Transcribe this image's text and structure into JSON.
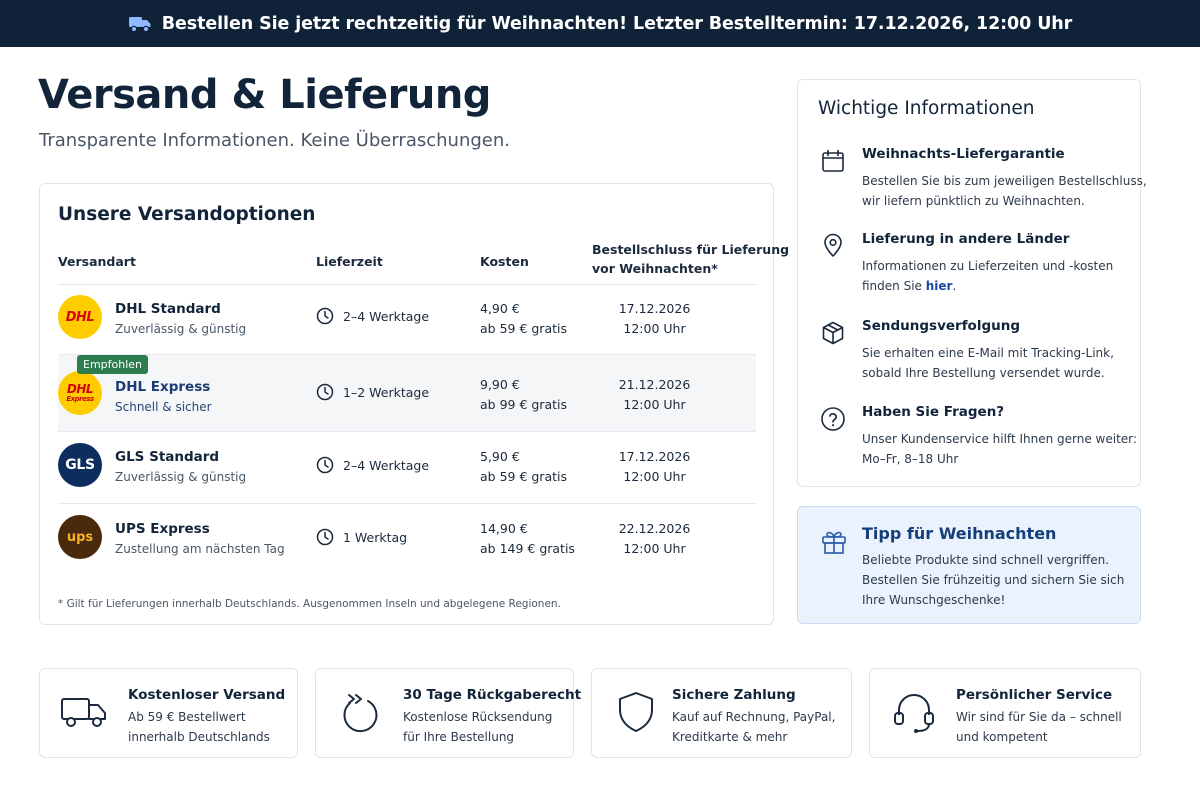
{
  "banner": {
    "text": "Bestellen Sie jetzt rechtzeitig für Weihnachten! Letzter Bestelltermin: 17.12.2026, 12:00 Uhr",
    "icon": "truck-icon"
  },
  "header": {
    "title": "Versand & Lieferung",
    "subtitle": "Transparente Informationen. Keine Überraschungen."
  },
  "shipping": {
    "title": "Unsere Versandoptionen",
    "columns": {
      "method": "Versandart",
      "time": "Lieferzeit",
      "cost": "Kosten",
      "deadline_line1": "Bestellschluss für Lieferung",
      "deadline_line2": "vor Weihnachten*"
    },
    "badge": "Empfohlen",
    "rows": [
      {
        "name": "DHL Standard",
        "desc": "Zuverlässig & günstig",
        "time": "2–4 Werktage",
        "cost": "4,90 €",
        "cost_note": "ab 59 € gratis",
        "deadline_date": "17.12.2026",
        "deadline_time": "12:00 Uhr",
        "logo": "DHL"
      },
      {
        "name": "DHL Express",
        "desc": "Schnell & sicher",
        "time": "1–2 Werktage",
        "cost": "9,90 €",
        "cost_note": "ab 99 € gratis",
        "deadline_date": "21.12.2026",
        "deadline_time": "12:00 Uhr",
        "logo": "DHL",
        "logo_sub": "Express"
      },
      {
        "name": "GLS Standard",
        "desc": "Zuverlässig & günstig",
        "time": "2–4 Werktage",
        "cost": "5,90 €",
        "cost_note": "ab 59 € gratis",
        "deadline_date": "17.12.2026",
        "deadline_time": "12:00 Uhr",
        "logo": "GLS"
      },
      {
        "name": "UPS Express",
        "desc": "Zustellung am nächsten Tag",
        "time": "1 Werktag",
        "cost": "14,90 €",
        "cost_note": "ab 149 € gratis",
        "deadline_date": "22.12.2026",
        "deadline_time": "12:00 Uhr",
        "logo": "ups"
      }
    ],
    "footnote": "* Gilt für Lieferungen innerhalb Deutschlands. Ausgenommen Inseln und abgelegene Regionen."
  },
  "info": {
    "title": "Wichtige Informationen",
    "items": [
      {
        "title": "Weihnachts-Liefergarantie",
        "line1": "Bestellen Sie bis zum jeweiligen Bestellschluss,",
        "line2": "wir liefern pünktlich zu Weihnachten.",
        "icon": "calendar-icon"
      },
      {
        "title": "Lieferung in andere Länder",
        "line1": "Informationen zu Lieferzeiten und -kosten",
        "line2_prefix": "finden Sie ",
        "link": "hier",
        "line2_suffix": ".",
        "icon": "map-pin-icon"
      },
      {
        "title": "Sendungsverfolgung",
        "line1": "Sie erhalten eine E-Mail mit Tracking-Link,",
        "line2": "sobald Ihre Bestellung versendet wurde.",
        "icon": "package-icon"
      },
      {
        "title": "Haben Sie Fragen?",
        "line1": "Unser Kundenservice hilft Ihnen gerne weiter:",
        "line2": "Mo–Fr, 8–18 Uhr",
        "icon": "question-icon"
      }
    ]
  },
  "tip": {
    "title": "Tipp für Weihnachten",
    "line1": "Beliebte Produkte sind schnell vergriffen.",
    "line2": "Bestellen Sie frühzeitig und sichern Sie sich",
    "line3": "Ihre Wunschgeschenke!",
    "icon": "gift-icon"
  },
  "features": [
    {
      "title": "Kostenloser Versand",
      "line1": "Ab 59 € Bestellwert",
      "line2": "innerhalb Deutschlands",
      "icon": "truck-icon"
    },
    {
      "title": "30 Tage Rückgaberecht",
      "line1": "Kostenlose Rücksendung",
      "line2": "für Ihre Bestellung",
      "icon": "return-icon"
    },
    {
      "title": "Sichere Zahlung",
      "line1": "Kauf auf Rechnung, PayPal,",
      "line2": "Kreditkarte & mehr",
      "icon": "shield-icon"
    },
    {
      "title": "Persönlicher Service",
      "line1": "Wir sind für Sie da – schnell",
      "line2": "und kompetent",
      "icon": "headset-icon"
    }
  ],
  "colors": {
    "banner_bg": "#0f2238",
    "dhl_yellow": "#ffcc00",
    "dhl_red": "#d40511",
    "gls_blue": "#0d2d5e",
    "ups_brown": "#4a2a0c",
    "badge_green": "#2e7d4f",
    "tip_bg": "#e9f2fd",
    "link_blue": "#1a47a8"
  }
}
